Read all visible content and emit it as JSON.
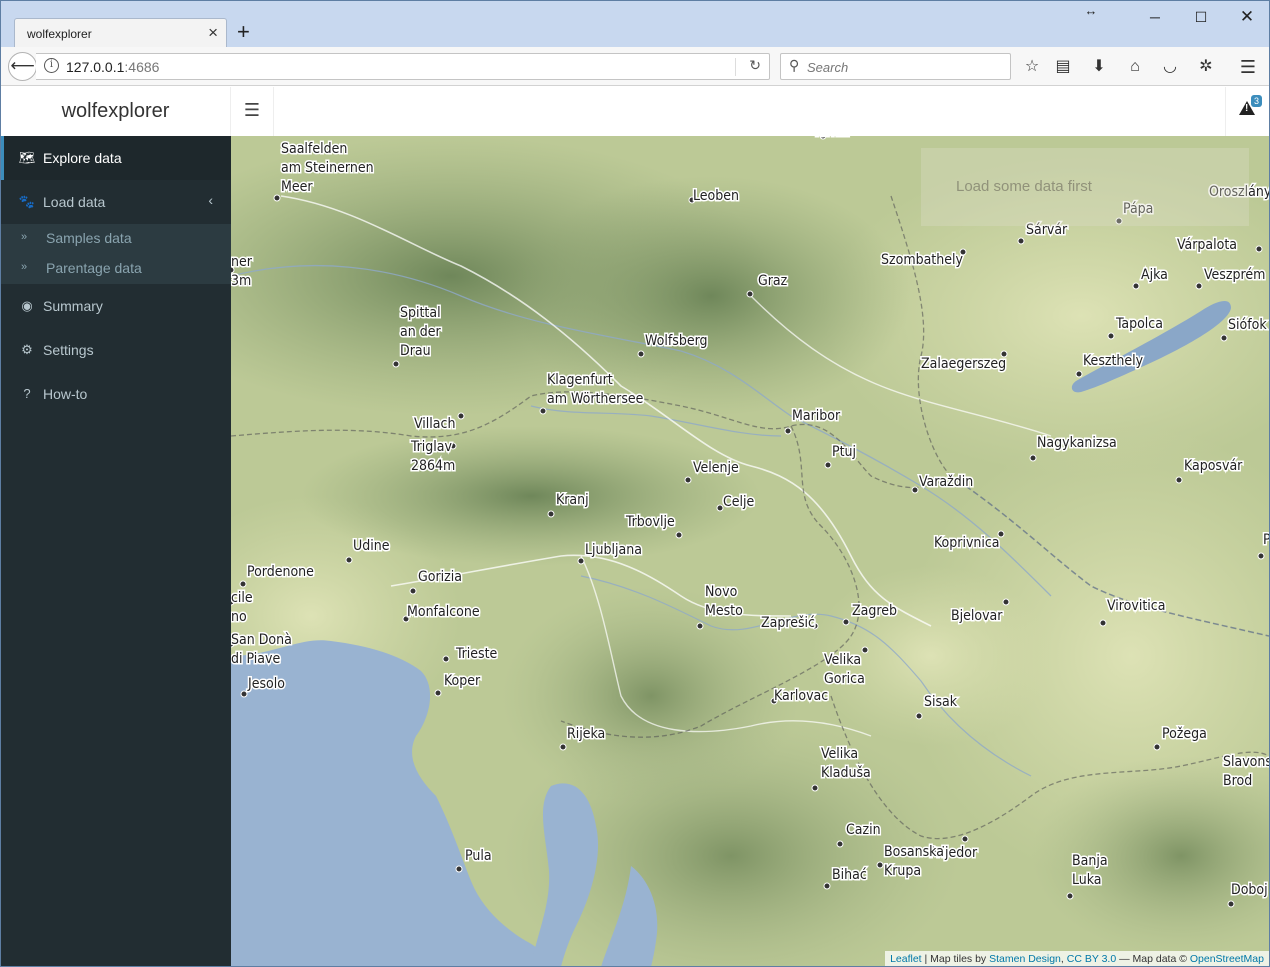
{
  "browser": {
    "tab_title": "wolfexplorer",
    "url_host": "127.0.0.1",
    "url_port": ":4686",
    "search_placeholder": "Search"
  },
  "app": {
    "title": "wolfexplorer",
    "alert_count": "3"
  },
  "sidebar": {
    "items": [
      {
        "label": "Explore data",
        "icon": "map-icon",
        "active": true
      },
      {
        "label": "Load data",
        "icon": "paw-icon"
      },
      {
        "label": "Summary",
        "icon": "eye-icon"
      },
      {
        "label": "Settings",
        "icon": "gears-icon"
      },
      {
        "label": "How-to",
        "icon": "question-circle-icon"
      }
    ],
    "submenu": [
      {
        "label": "Samples data",
        "icon": "angle-double-right-icon"
      },
      {
        "label": "Parentage data",
        "icon": "angle-double-right-icon"
      }
    ]
  },
  "map": {
    "notice": "Load some data first",
    "attribution": {
      "leaflet": "Leaflet",
      "tiles_prefix": " | Map tiles by ",
      "stamen": "Stamen Design",
      "sep": ", ",
      "license": "CC BY 3.0",
      "data_prefix": " — Map data © ",
      "osm": "OpenStreetMap"
    },
    "places": [
      {
        "name": "Saalfelden am Steinernen Meer",
        "lines": [
          "Saalfelden",
          "am Steinernen",
          "Meer"
        ]
      },
      {
        "name": "Leoben",
        "lines": [
          "Leoben"
        ]
      },
      {
        "name": "Graz",
        "lines": [
          "Graz"
        ]
      },
      {
        "name": "Szombathely",
        "lines": [
          "Szombathely"
        ]
      },
      {
        "name": "Sárvár",
        "lines": [
          "Sárvár"
        ]
      },
      {
        "name": "Pápa",
        "lines": [
          "Pápa"
        ]
      },
      {
        "name": "Oroszlány",
        "lines": [
          "Oroszlány"
        ]
      },
      {
        "name": "Várpalota",
        "lines": [
          "Várpalota"
        ]
      },
      {
        "name": "Ajka",
        "lines": [
          "Ajka"
        ]
      },
      {
        "name": "Veszprém",
        "lines": [
          "Veszprém"
        ]
      },
      {
        "name": "Tapolca",
        "lines": [
          "Tapolca"
        ]
      },
      {
        "name": "Siófok",
        "lines": [
          "Siófok"
        ]
      },
      {
        "name": "Keszthely",
        "lines": [
          "Keszthely"
        ]
      },
      {
        "name": "Spittal an der Drau",
        "lines": [
          "Spittal",
          "an der",
          "Drau"
        ]
      },
      {
        "name": "Wolfsberg",
        "lines": [
          "Wolfsberg"
        ]
      },
      {
        "name": "Zalaegerszeg",
        "lines": [
          "Zalaegerszeg"
        ]
      },
      {
        "name": "Klagenfurt am Wörthersee",
        "lines": [
          "Klagenfurt",
          "am Wörthersee"
        ]
      },
      {
        "name": "Villach",
        "lines": [
          "Villach"
        ]
      },
      {
        "name": "Triglav 2864m",
        "lines": [
          "Triglav",
          "2864m"
        ]
      },
      {
        "name": "Maribor",
        "lines": [
          "Maribor"
        ]
      },
      {
        "name": "Ptuj",
        "lines": [
          "Ptuj"
        ]
      },
      {
        "name": "Nagykanizsa",
        "lines": [
          "Nagykanizsa"
        ]
      },
      {
        "name": "Kaposvár",
        "lines": [
          "Kaposvár"
        ]
      },
      {
        "name": "Velenje",
        "lines": [
          "Velenje"
        ]
      },
      {
        "name": "Varaždin",
        "lines": [
          "Varaždin"
        ]
      },
      {
        "name": "Kranj",
        "lines": [
          "Kranj"
        ]
      },
      {
        "name": "Celje",
        "lines": [
          "Celje"
        ]
      },
      {
        "name": "Trbovlje",
        "lines": [
          "Trbovlje"
        ]
      },
      {
        "name": "Ljubljana",
        "lines": [
          "Ljubljana"
        ]
      },
      {
        "name": "Koprivnica",
        "lines": [
          "Koprivnica"
        ]
      },
      {
        "name": "Udine",
        "lines": [
          "Udine"
        ]
      },
      {
        "name": "Pordenone",
        "lines": [
          "Pordenone"
        ]
      },
      {
        "name": "Gorizia",
        "lines": [
          "Gorizia"
        ]
      },
      {
        "name": "Monfalcone",
        "lines": [
          "Monfalcone"
        ]
      },
      {
        "name": "Novo Mesto",
        "lines": [
          "Novo",
          "Mesto"
        ]
      },
      {
        "name": "Zagreb",
        "lines": [
          "Zagreb"
        ]
      },
      {
        "name": "Zaprešić",
        "lines": [
          "Zaprešić"
        ]
      },
      {
        "name": "Bjelovar",
        "lines": [
          "Bjelovar"
        ]
      },
      {
        "name": "Virovitica",
        "lines": [
          "Virovitica"
        ]
      },
      {
        "name": "San Donà di Piave",
        "lines": [
          "San Donà",
          "di Piave"
        ]
      },
      {
        "name": "Trieste",
        "lines": [
          "Trieste"
        ]
      },
      {
        "name": "Koper",
        "lines": [
          "Koper"
        ]
      },
      {
        "name": "Velika Gorica",
        "lines": [
          "Velika",
          "Gorica"
        ]
      },
      {
        "name": "Jesolo",
        "lines": [
          "Jesolo"
        ]
      },
      {
        "name": "Karlovac",
        "lines": [
          "Karlovac"
        ]
      },
      {
        "name": "Sisak",
        "lines": [
          "Sisak"
        ]
      },
      {
        "name": "Rijeka",
        "lines": [
          "Rijeka"
        ]
      },
      {
        "name": "Požega",
        "lines": [
          "Požega"
        ]
      },
      {
        "name": "Velika Kladuša",
        "lines": [
          "Velika",
          "Kladuša"
        ]
      },
      {
        "name": "Slavonski Brod",
        "lines": [
          "Slavons",
          "Brod"
        ]
      },
      {
        "name": "Cazin",
        "lines": [
          "Cazin"
        ]
      },
      {
        "name": "Prijedor",
        "lines": [
          "Prijedor"
        ]
      },
      {
        "name": "Bihać",
        "lines": [
          "Bihać"
        ]
      },
      {
        "name": "Bosanska Krupa",
        "lines": [
          "Bosanska",
          "Krupa"
        ]
      },
      {
        "name": "Banja Luka",
        "lines": [
          "Banja",
          "Luka"
        ]
      },
      {
        "name": "Pula",
        "lines": [
          "Pula"
        ]
      },
      {
        "name": "Doboj",
        "lines": [
          "Doboj"
        ]
      },
      {
        "name": "Terniz",
        "lines": [
          "Terniz"
        ]
      },
      {
        "name": "ner 3m",
        "lines": [
          "ner",
          "3m"
        ]
      },
      {
        "name": "cile no",
        "lines": [
          "cile",
          "no"
        ]
      },
      {
        "name": "P",
        "lines": [
          "P"
        ]
      }
    ]
  }
}
